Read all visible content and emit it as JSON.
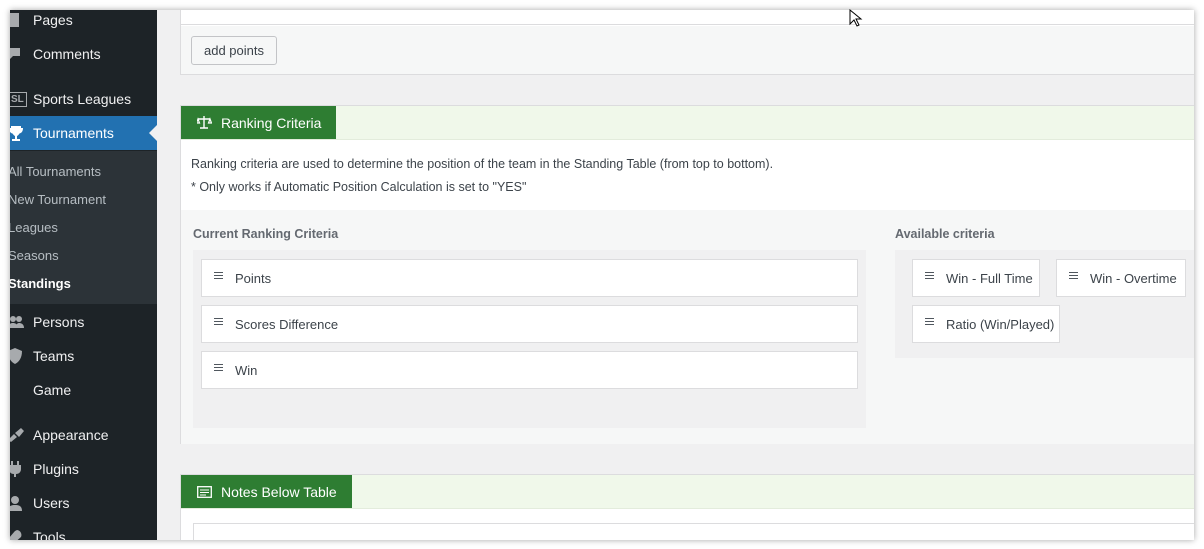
{
  "sidebar": {
    "menu": [
      {
        "label": "Pages",
        "icon": "pages-icon"
      },
      {
        "label": "Comments",
        "icon": "comments-icon"
      },
      {
        "label": "Sports Leagues",
        "icon": "sl-logo-icon",
        "icon_text": "SL"
      },
      {
        "label": "Tournaments",
        "icon": "trophy-icon",
        "active": true
      },
      {
        "label": "Persons",
        "icon": "persons-icon"
      },
      {
        "label": "Teams",
        "icon": "shield-icon"
      },
      {
        "label": "Game",
        "icon": "game-icon"
      },
      {
        "label": "Appearance",
        "icon": "paintbrush-icon"
      },
      {
        "label": "Plugins",
        "icon": "plugins-icon"
      },
      {
        "label": "Users",
        "icon": "users-icon"
      },
      {
        "label": "Tools",
        "icon": "tools-icon"
      }
    ],
    "submenu": [
      {
        "label": "All Tournaments"
      },
      {
        "label": "New Tournament"
      },
      {
        "label": "Leagues"
      },
      {
        "label": "Seasons"
      },
      {
        "label": "Standings",
        "current": true
      }
    ]
  },
  "points_panel": {
    "add_points_label": "add points"
  },
  "ranking": {
    "title": "Ranking Criteria",
    "icon": "balance-scale-icon",
    "description_1": "Ranking criteria are used to determine the position of the team in the Standing Table (from top to bottom).",
    "description_2": "* Only works if Automatic Position Calculation is set to \"YES\"",
    "current_heading": "Current Ranking Criteria",
    "current": [
      "Points",
      "Scores Difference",
      "Win"
    ],
    "available_heading": "Available criteria",
    "available": [
      "Win - Full Time",
      "Win - Overtime",
      "Ratio (Win/Played)"
    ]
  },
  "notes": {
    "title": "Notes Below Table",
    "icon": "note-icon"
  },
  "colors": {
    "sidebar_bg": "#1d2327",
    "active_menu": "#2271b1",
    "panel_header_accent": "#2e7d32",
    "panel_header_band": "#f0f8ea"
  }
}
